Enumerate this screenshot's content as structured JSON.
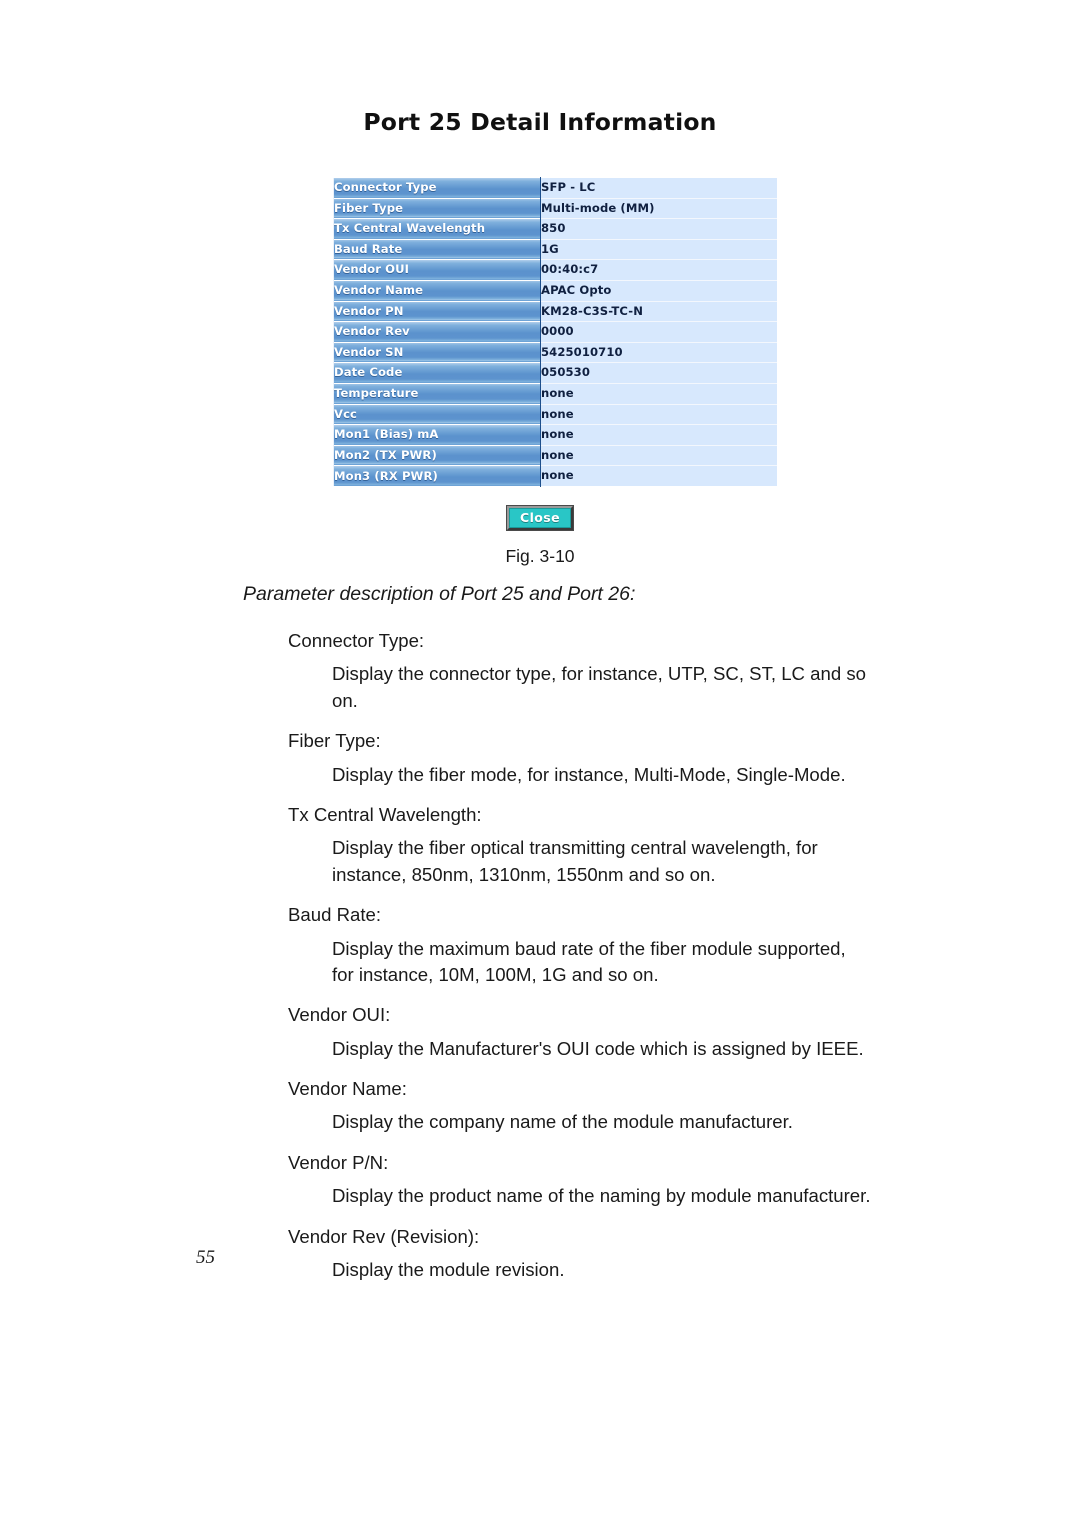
{
  "figure": {
    "panel_title": "Port 25 Detail Information",
    "caption": "Fig. 3-10",
    "close_label": "Close",
    "colors": {
      "key_cell_blue": "#5b92cd",
      "value_cell_blue": "#d7e8fd",
      "close_button_teal": "#29c6c6"
    },
    "table": {
      "rows": [
        {
          "key": "Connector Type",
          "value": "SFP - LC"
        },
        {
          "key": "Fiber Type",
          "value": "Multi-mode (MM)"
        },
        {
          "key": "Tx Central Wavelength",
          "value": "850"
        },
        {
          "key": "Baud Rate",
          "value": "1G"
        },
        {
          "key": "Vendor OUI",
          "value": "00:40:c7"
        },
        {
          "key": "Vendor Name",
          "value": "APAC Opto"
        },
        {
          "key": "Vendor PN",
          "value": "KM28-C3S-TC-N"
        },
        {
          "key": "Vendor Rev",
          "value": "0000"
        },
        {
          "key": "Vendor SN",
          "value": "5425010710"
        },
        {
          "key": "Date Code",
          "value": "050530"
        },
        {
          "key": "Temperature",
          "value": "none"
        },
        {
          "key": "Vcc",
          "value": "none"
        },
        {
          "key": "Mon1 (Bias) mA",
          "value": "none"
        },
        {
          "key": "Mon2 (TX PWR)",
          "value": "none"
        },
        {
          "key": "Mon3 (RX PWR)",
          "value": "none"
        }
      ]
    }
  },
  "body": {
    "section_heading": "Parameter description of Port 25 and Port 26:",
    "definitions": [
      {
        "term": "Connector Type:",
        "description": "Display the connector type, for instance, UTP, SC, ST, LC and so on."
      },
      {
        "term": "Fiber Type:",
        "description": "Display the fiber mode, for instance, Multi-Mode, Single-Mode."
      },
      {
        "term": "Tx Central Wavelength:",
        "description": "Display the fiber optical transmitting central wavelength, for instance, 850nm, 1310nm, 1550nm and so on."
      },
      {
        "term": "Baud Rate:",
        "description": "Display the maximum baud rate of the fiber module supported, for instance, 10M, 100M, 1G and so on."
      },
      {
        "term": "Vendor OUI:",
        "description": "Display the Manufacturer's OUI code which is assigned by IEEE."
      },
      {
        "term": "Vendor Name:",
        "description": "Display the company name of the module manufacturer."
      },
      {
        "term": "Vendor P/N:",
        "description": "Display the product name of the naming by module manufacturer."
      },
      {
        "term": "Vendor Rev (Revision):",
        "description": "Display the module revision."
      }
    ]
  },
  "page_number": "55"
}
